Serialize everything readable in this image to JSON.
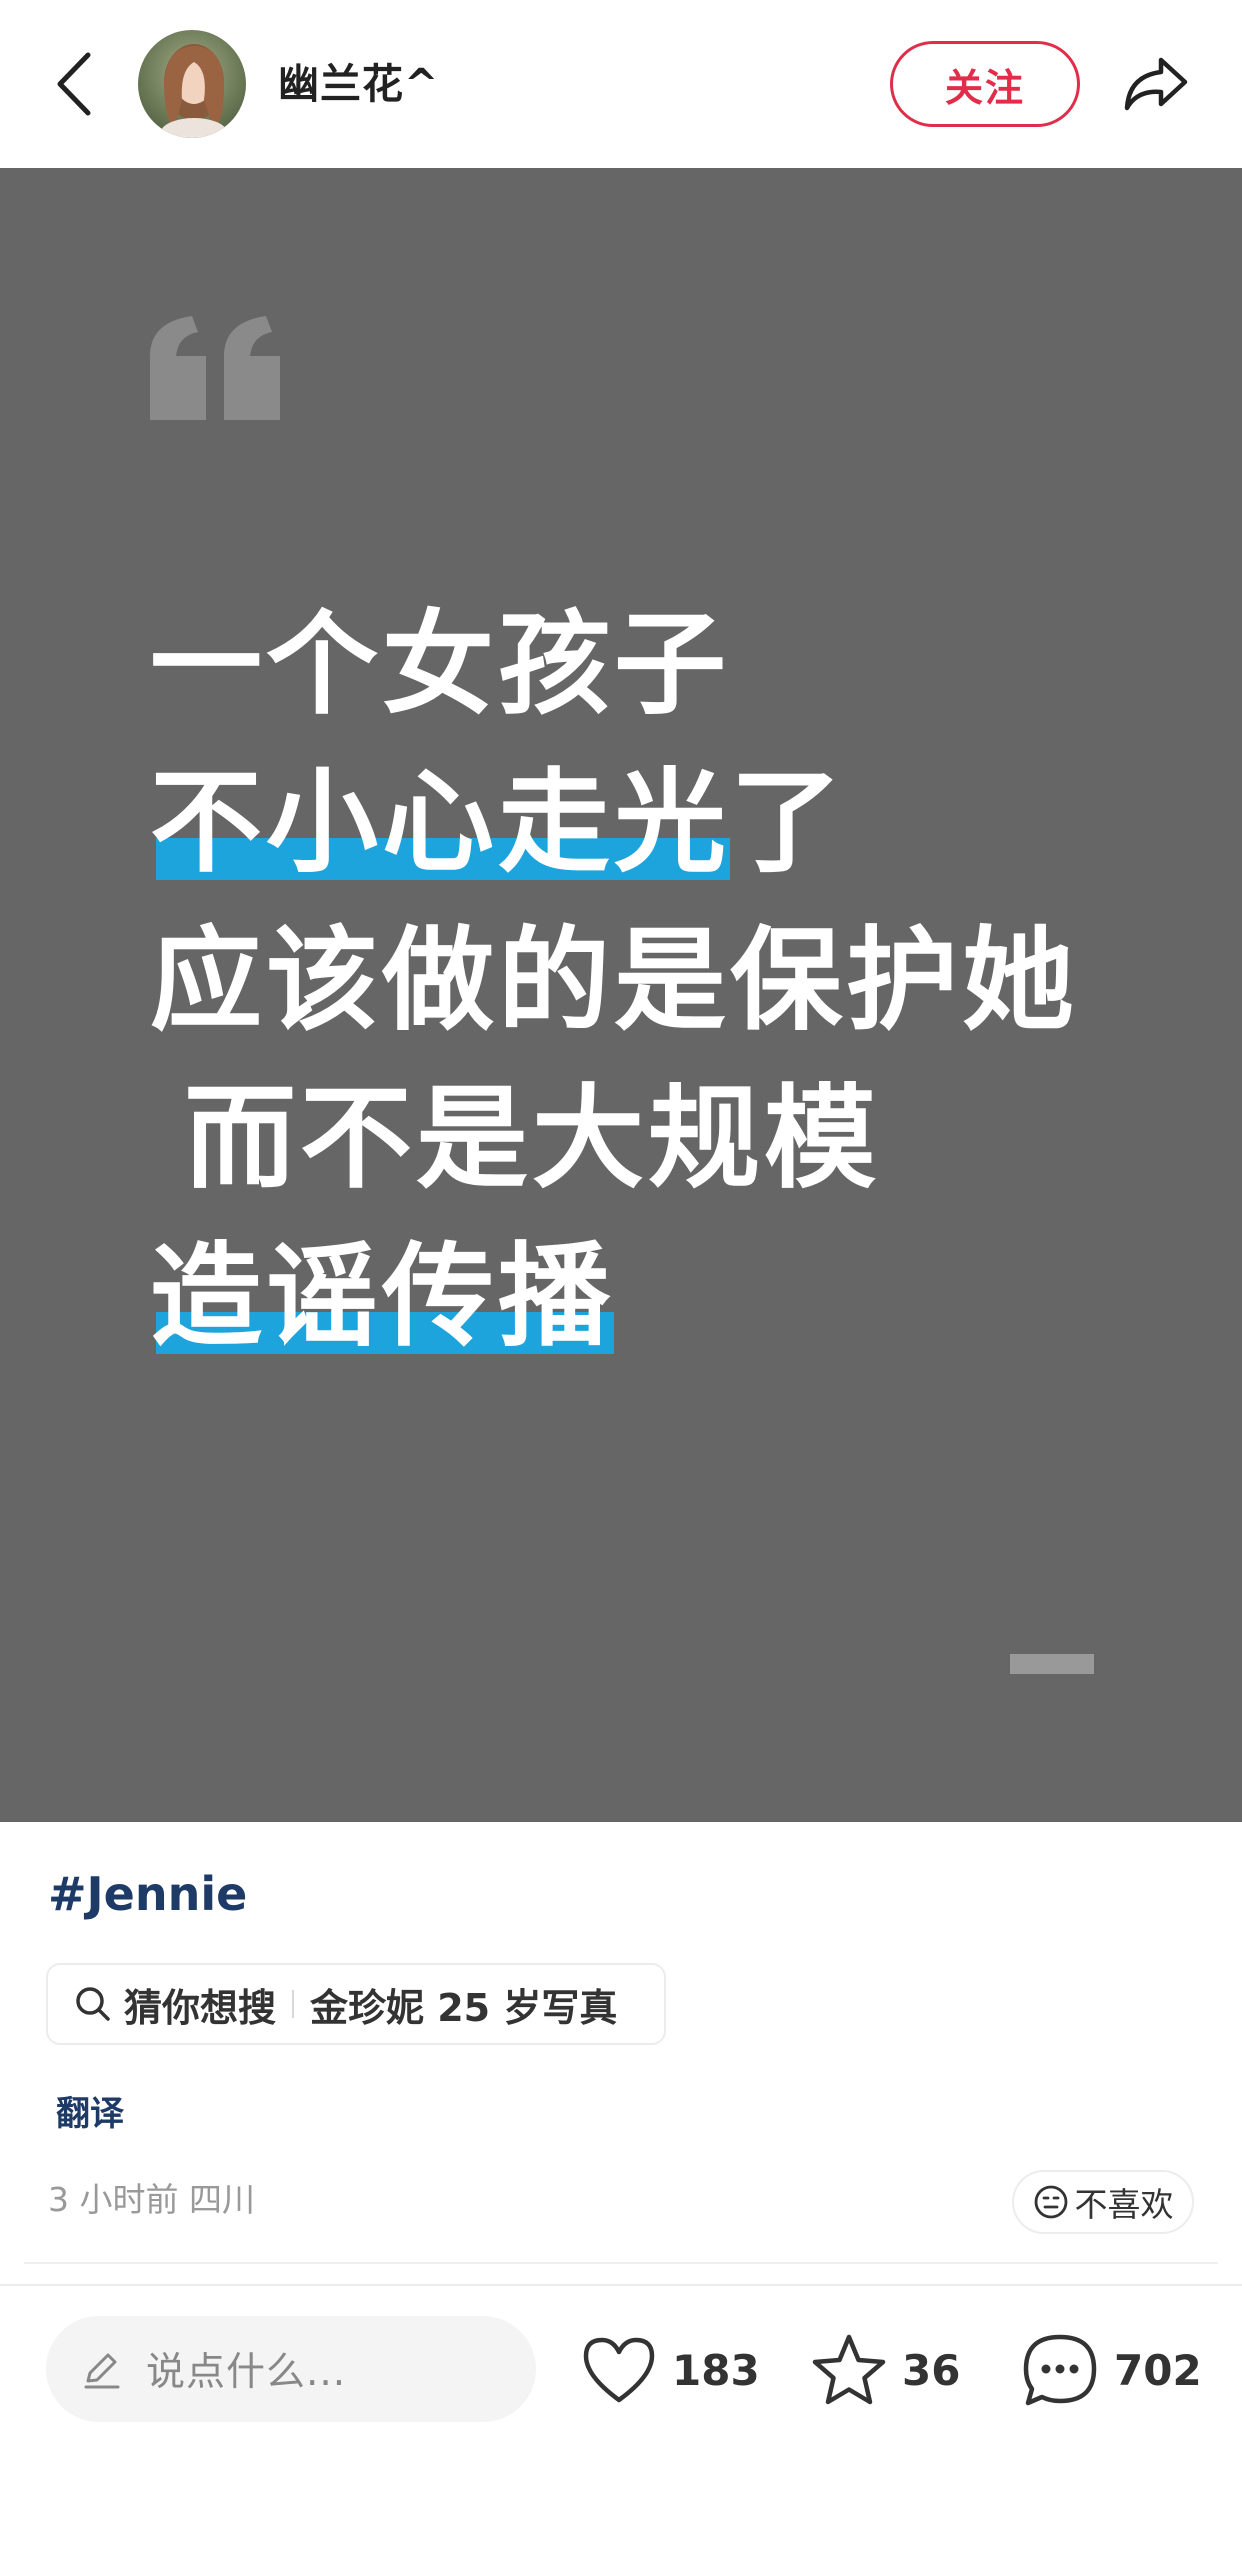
{
  "header": {
    "author_name": "幽兰花^",
    "follow_label": "关注"
  },
  "post_image": {
    "lines": [
      {
        "text": "一个女孩子",
        "highlight": ""
      },
      {
        "text": "了",
        "highlight": "不小心走光"
      },
      {
        "text": "应该做的是保护她",
        "highlight": ""
      },
      {
        "text": "而不是大规模",
        "highlight": ""
      },
      {
        "text": "",
        "highlight": "造谣传播"
      }
    ],
    "background_color": "#666666",
    "highlight_color": "#1ea4dd"
  },
  "content": {
    "hashtag": "#Jennie",
    "search_chip": {
      "prefix": "猜你想搜",
      "query": "金珍妮 25 岁写真"
    },
    "translate_label": "翻译",
    "meta": "3 小时前 四川",
    "dislike_label": "不喜欢"
  },
  "action_bar": {
    "comment_placeholder": "说点什么...",
    "likes": "183",
    "collects": "36",
    "comments": "702"
  },
  "colors": {
    "accent_red": "#e02e4a",
    "link_blue": "#1e3a66"
  }
}
